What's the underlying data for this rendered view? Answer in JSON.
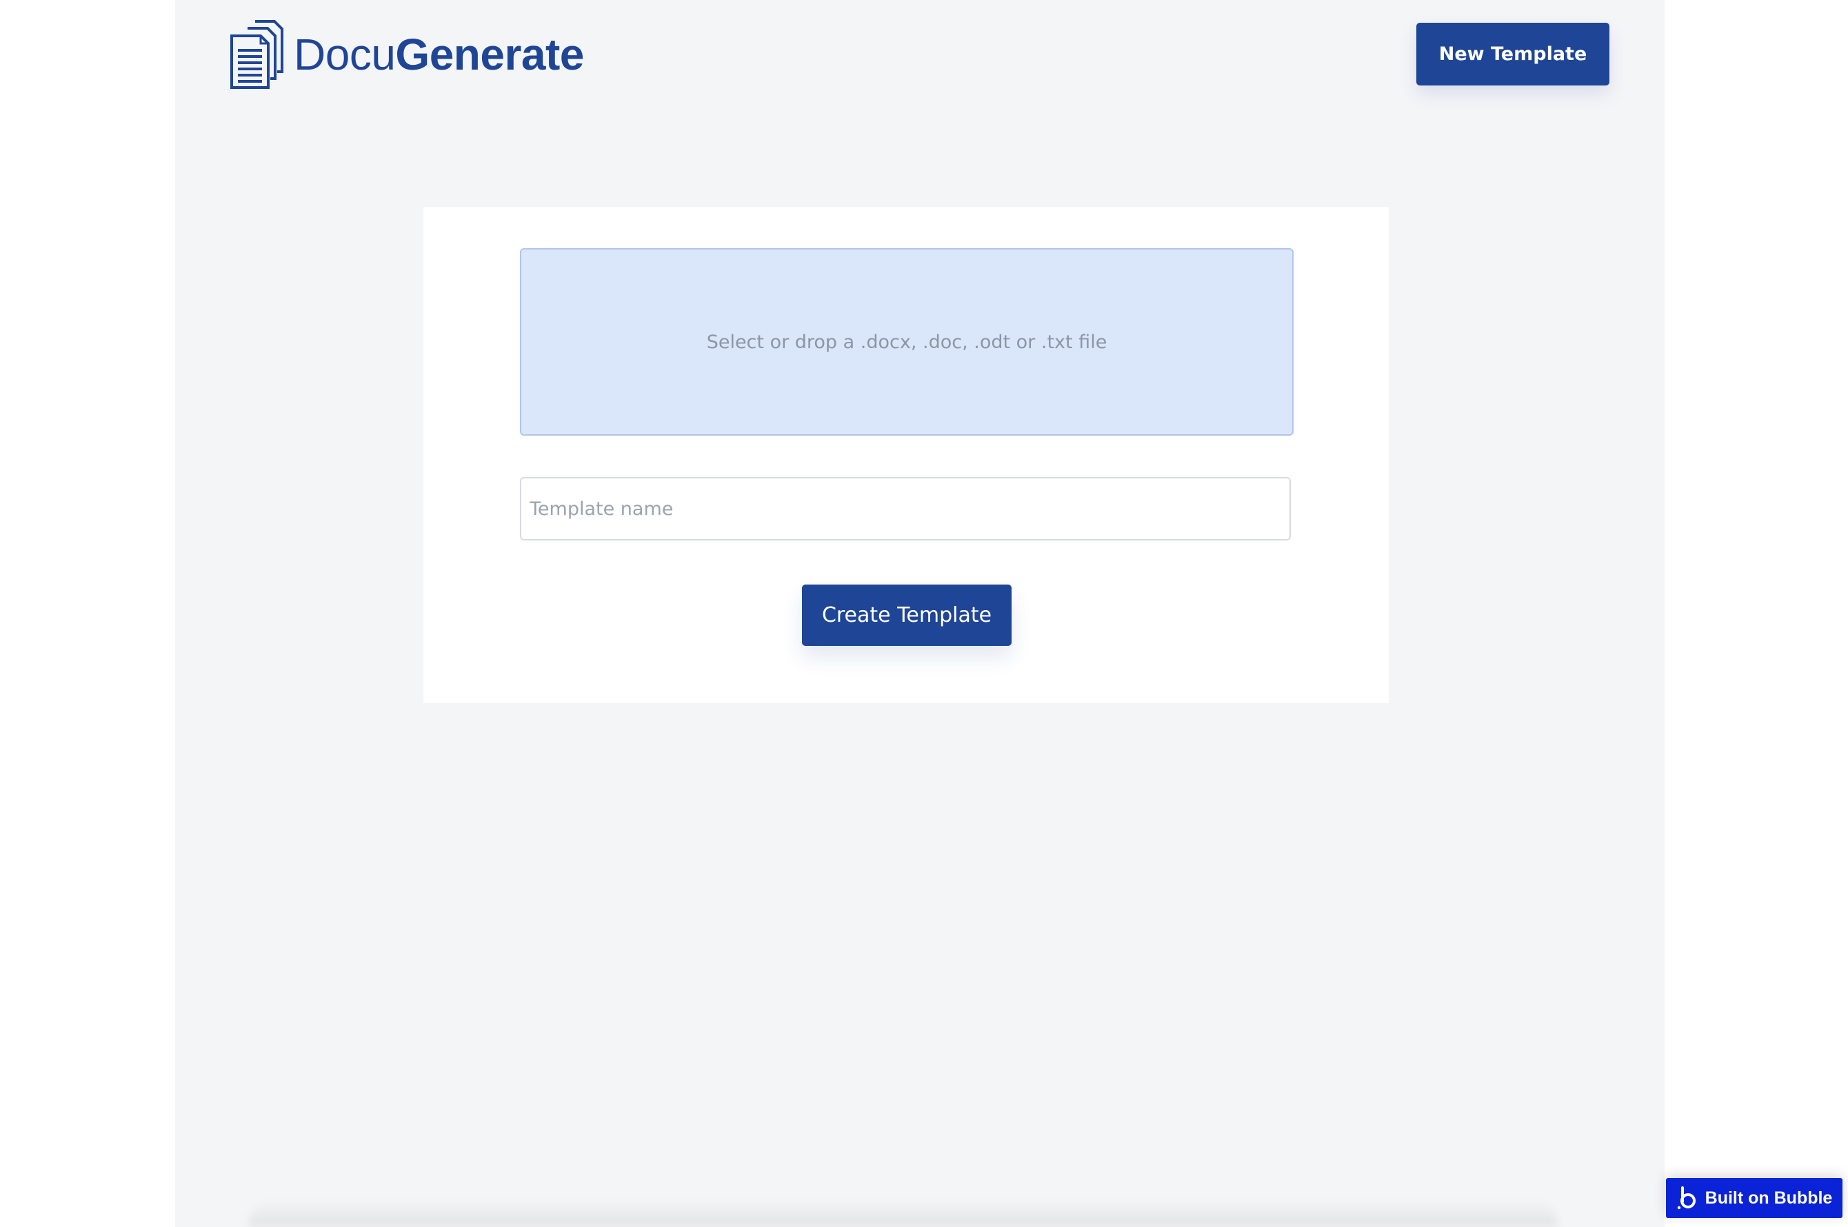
{
  "header": {
    "logo_text_light": "Docu",
    "logo_text_bold": "Generate",
    "logo_icon": "documents-icon",
    "new_template_label": "New Template"
  },
  "form": {
    "dropzone_text": "Select or drop a .docx, .doc, .odt or .txt file",
    "template_name_placeholder": "Template name",
    "template_name_value": "",
    "create_button_label": "Create Template"
  },
  "badge": {
    "text": "Built on Bubble",
    "icon": "bubble-logo-icon"
  },
  "colors": {
    "brand": "#1f4596",
    "page_background": "#f4f5f7",
    "dropzone_background": "#dae7fa",
    "badge_background": "#0b23d6"
  }
}
